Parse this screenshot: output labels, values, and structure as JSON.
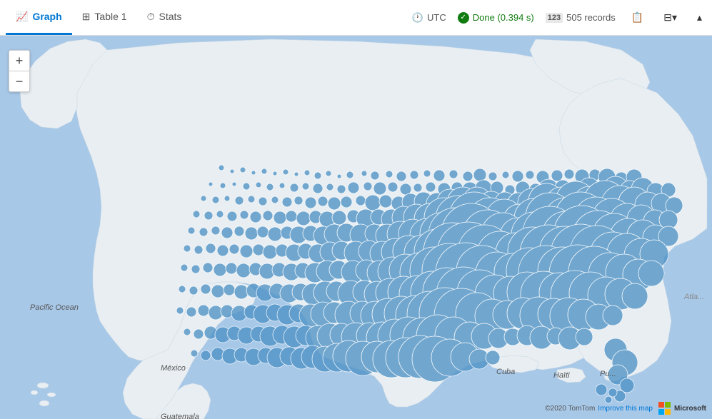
{
  "header": {
    "tabs": [
      {
        "id": "graph",
        "label": "Graph",
        "icon": "📈",
        "active": true
      },
      {
        "id": "table1",
        "label": "Table 1",
        "icon": "🗃",
        "active": false
      },
      {
        "id": "stats",
        "label": "Stats",
        "icon": "⏱",
        "active": false
      }
    ],
    "timezone": "UTC",
    "status": "Done (0.394 s)",
    "records": "505 records",
    "records_icon": "123"
  },
  "map": {
    "ocean_label": "Pacific Ocean",
    "country_labels": [
      "México",
      "Cuba",
      "Haïti",
      "Guatemala"
    ],
    "attribution": "©2020 TomTom",
    "improve_map": "Improve this map",
    "zoom_in": "+",
    "zoom_out": "−"
  }
}
